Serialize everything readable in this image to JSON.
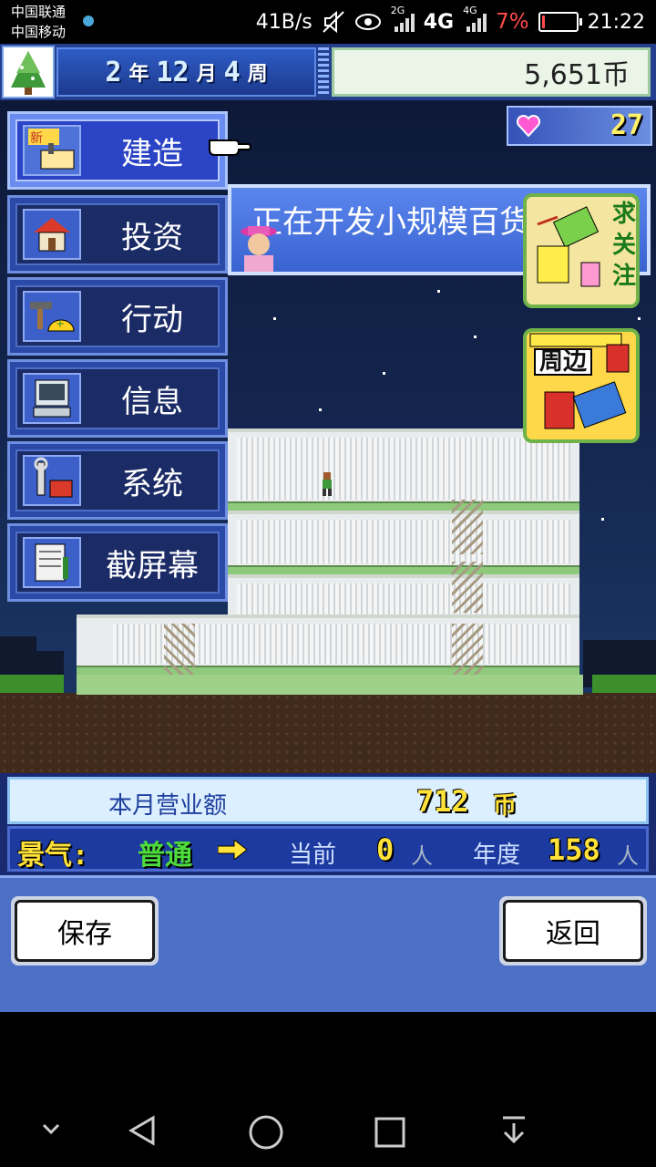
{
  "status_bar": {
    "carrier_1": "中国联通",
    "carrier_2": "中国移动",
    "speed": "41B/s",
    "net_1": "2G",
    "net_2": "4G",
    "net_3": "4G",
    "battery_pct": "7%",
    "time": "21:22"
  },
  "top_bar": {
    "year": "2",
    "year_unit": "年",
    "month": "12",
    "month_unit": "月",
    "week": "4",
    "week_unit": "周",
    "money": "5,651币",
    "hearts": "27"
  },
  "menu": [
    {
      "label": "建造",
      "icon": "new-build-icon",
      "active": true
    },
    {
      "label": "投资",
      "icon": "house-icon"
    },
    {
      "label": "行动",
      "icon": "hammer-helmet-icon"
    },
    {
      "label": "信息",
      "icon": "computer-icon"
    },
    {
      "label": "系统",
      "icon": "wrench-icon"
    },
    {
      "label": "截屏幕",
      "icon": "document-icon"
    }
  ],
  "banner": {
    "text": "正在开发小规模百货"
  },
  "badges": {
    "follow": {
      "lines": [
        "求",
        "关",
        "注"
      ]
    },
    "merch": {
      "label": "周边"
    }
  },
  "info": {
    "monthly_label": "本月营业额",
    "monthly_value": "712",
    "monthly_unit": "币",
    "mood_label": "景气:",
    "mood_value": "普通",
    "current_label": "当前",
    "current_value": "0",
    "current_unit": "人",
    "year_label": "年度",
    "year_value": "158",
    "year_unit": "人"
  },
  "buttons": {
    "save": "保存",
    "back": "返回"
  },
  "colors": {
    "accent_blue": "#2b49a6",
    "gold": "#ffe23a",
    "green": "#4ddc3c"
  }
}
